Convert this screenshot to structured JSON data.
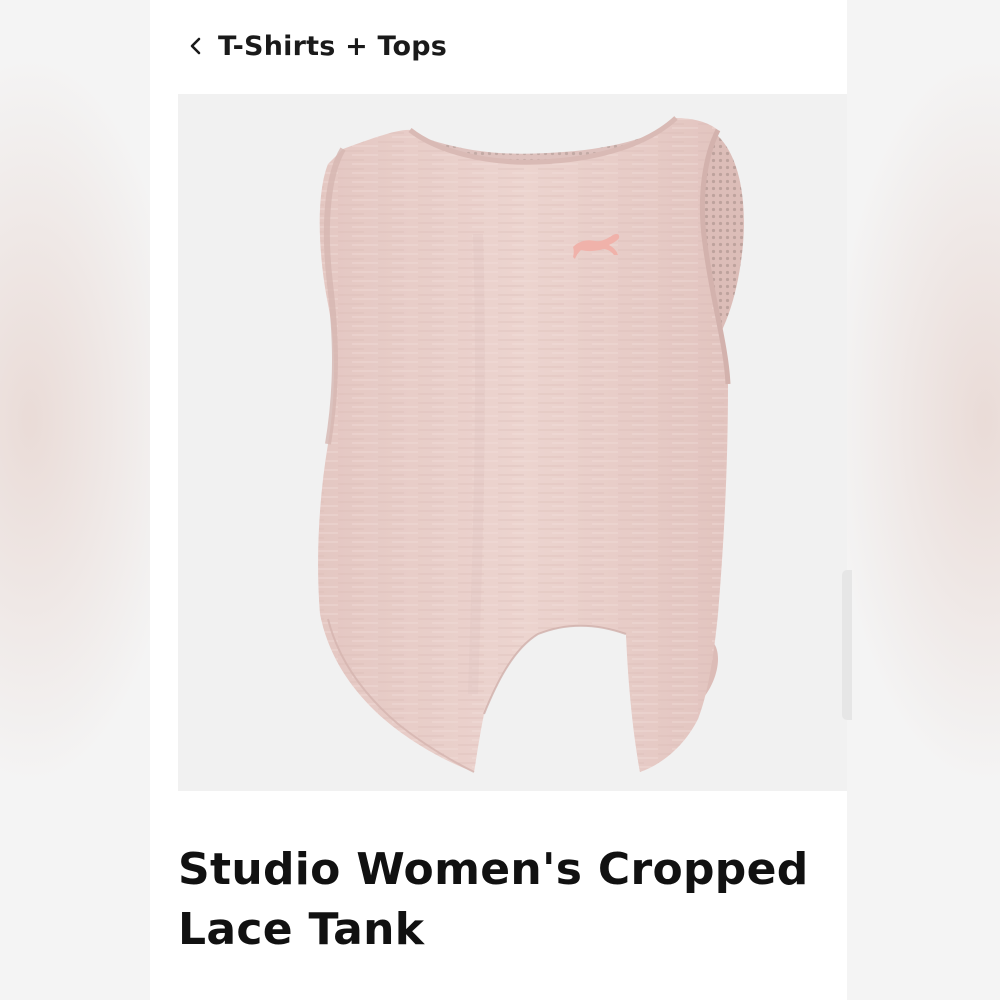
{
  "nav": {
    "back_label": "T-Shirts + Tops",
    "back_icon": "chevron-left-icon"
  },
  "product": {
    "title": "Studio Women's Cropped Lace Tank",
    "image_subject": "blush pink cropped tank top with split back hem",
    "logo_icon": "puma-cat-icon"
  },
  "colors": {
    "garment": "#e9cfca",
    "garment_shadow": "#d9b9b4",
    "image_bg": "#f1f1f1",
    "text": "#111111"
  }
}
